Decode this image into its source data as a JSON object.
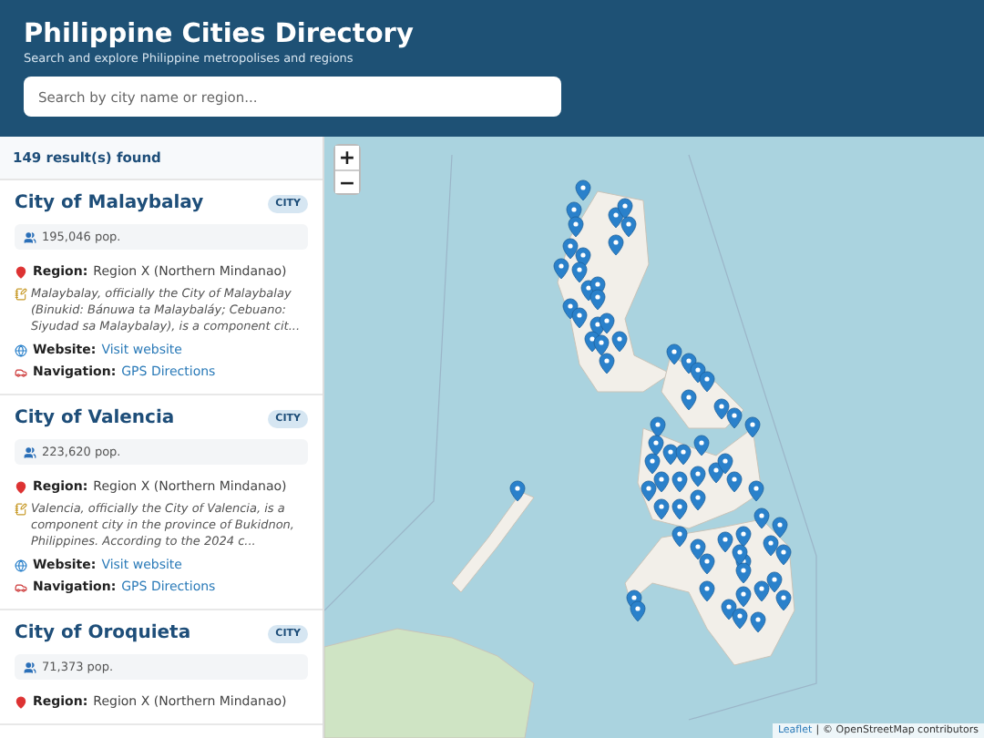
{
  "header": {
    "title": "Philippine Cities Directory",
    "subtitle": "Search and explore Philippine metropolises and regions",
    "search": {
      "placeholder": "Search by city name or region..."
    }
  },
  "results": {
    "count": "149 result(s) found"
  },
  "cards": [
    {
      "name": "City of Malaybalay",
      "badge": "CITY",
      "population": "195,046 pop.",
      "region_label": "Region:",
      "region": "Region X (Northern Mindanao)",
      "description": "Malaybalay, officially the City of Malaybalay (Binukid: Bánuwa ta Malaybaláy; Cebuano: Siyudad sa Malaybalay), is a component cit...",
      "website_label": "Website:",
      "website": "Visit website",
      "navigation_label": "Navigation:",
      "navigation": "GPS Directions"
    },
    {
      "name": "City of Valencia",
      "badge": "CITY",
      "population": "223,620 pop.",
      "region_label": "Region:",
      "region": "Region X (Northern Mindanao)",
      "description": "Valencia, officially the City of Valencia, is a component city in the province of Bukidnon, Philippines. According to the 2024 c...",
      "website_label": "Website:",
      "website": "Visit website",
      "navigation_label": "Navigation:",
      "navigation": "GPS Directions"
    },
    {
      "name": "City of Oroquieta",
      "badge": "CITY",
      "population": "71,373 pop.",
      "region_label": "Region:",
      "region": "Region X (Northern Mindanao)"
    }
  ],
  "map": {
    "zoom_in": "+",
    "zoom_out": "−",
    "attribution": {
      "link": "Leaflet",
      "separator": "|",
      "text": "© OpenStreetMap contributors"
    }
  }
}
